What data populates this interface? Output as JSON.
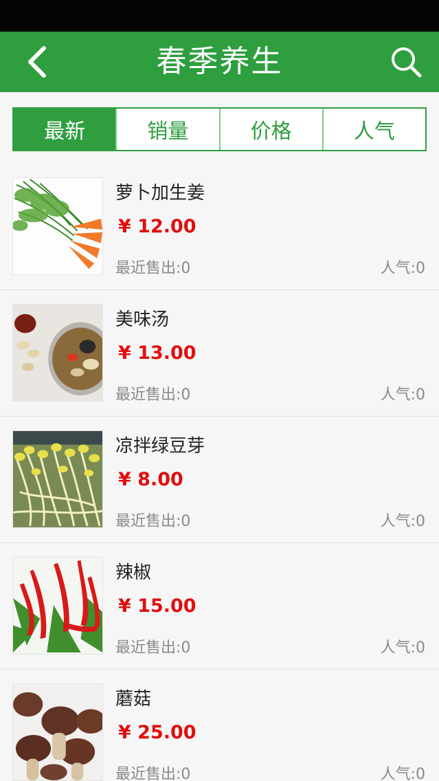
{
  "header": {
    "title": "春季养生",
    "back_icon": "chevron-left-icon",
    "search_icon": "search-icon"
  },
  "tabs": [
    {
      "label": "最新",
      "active": true
    },
    {
      "label": "销量",
      "active": false
    },
    {
      "label": "价格",
      "active": false
    },
    {
      "label": "人气",
      "active": false
    }
  ],
  "colors": {
    "primary": "#2e9e3f",
    "price": "#e10e0e",
    "muted": "#8a8a8a"
  },
  "products": [
    {
      "name": "萝卜加生姜",
      "price": "¥ 12.00",
      "sold": "最近售出:0",
      "popularity": "人气:0",
      "image": "carrot-image"
    },
    {
      "name": "美味汤",
      "price": "¥ 13.00",
      "sold": "最近售出:0",
      "popularity": "人气:0",
      "image": "soup-image"
    },
    {
      "name": "凉拌绿豆芽",
      "price": "¥ 8.00",
      "sold": "最近售出:0",
      "popularity": "人气:0",
      "image": "bean-sprouts-image"
    },
    {
      "name": "辣椒",
      "price": "¥ 15.00",
      "sold": "最近售出:0",
      "popularity": "人气:0",
      "image": "chili-pepper-image"
    },
    {
      "name": "蘑菇",
      "price": "¥ 25.00",
      "sold": "最近售出:0",
      "popularity": "人气:0",
      "image": "mushroom-image"
    }
  ]
}
